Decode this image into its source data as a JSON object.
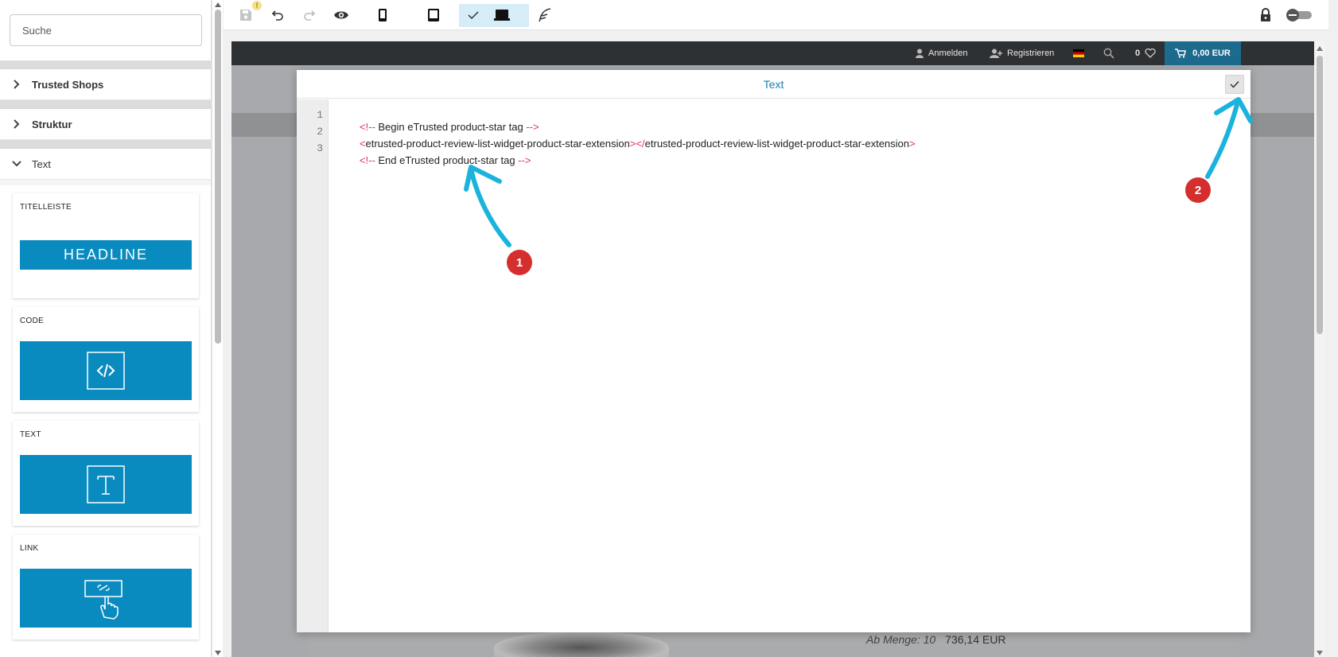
{
  "sidebar": {
    "search": {
      "placeholder": "Suche",
      "value": ""
    },
    "sections": [
      {
        "label": "Trusted Shops",
        "expanded": false
      },
      {
        "label": "Struktur",
        "expanded": false
      },
      {
        "label": "Text",
        "expanded": true
      }
    ],
    "widgets": [
      {
        "title": "TITELLEISTE",
        "preview": "HEADLINE",
        "icon": "headline-icon"
      },
      {
        "title": "CODE",
        "icon": "code-icon"
      },
      {
        "title": "TEXT",
        "icon": "text-icon"
      },
      {
        "title": "LINK",
        "icon": "link-click-icon"
      }
    ]
  },
  "toolbar": {
    "save_warning": "!",
    "icons": [
      "save-icon",
      "undo-icon",
      "redo-icon",
      "preview-eye-icon",
      "mobile-icon",
      "tablet-icon",
      "checkmark-icon",
      "desktop-icon",
      "feather-icon",
      "lock-icon",
      "toggle-switch"
    ]
  },
  "shop_header": {
    "login": "Anmelden",
    "register": "Registrieren",
    "wishlist_count": "0",
    "cart_total": "0,00 EUR"
  },
  "modal": {
    "title": "Text",
    "code_lines": [
      {
        "num": "1",
        "parts": [
          {
            "t": "<!-- ",
            "tag": true
          },
          {
            "t": "Begin eTrusted product-star tag",
            "tag": false
          },
          {
            "t": " -->",
            "tag": true
          }
        ]
      },
      {
        "num": "2",
        "parts": [
          {
            "t": "<",
            "tag": true
          },
          {
            "t": "etrusted-product-review-list-widget-product-star-extension",
            "tag": false
          },
          {
            "t": "></",
            "tag": true
          },
          {
            "t": "etrusted-product-review-list-widget-product-star-extension",
            "tag": false
          },
          {
            "t": ">",
            "tag": true
          }
        ]
      },
      {
        "num": "3",
        "parts": [
          {
            "t": "<!-- ",
            "tag": true
          },
          {
            "t": "End eTrusted product-star tag",
            "tag": false
          },
          {
            "t": " -->",
            "tag": true
          }
        ]
      }
    ]
  },
  "background_page": {
    "price_qty": "Ab Menge: 10",
    "price_value": "736,14 EUR"
  },
  "annotations": {
    "badge1": "1",
    "badge2": "2"
  },
  "colors": {
    "accent": "#0a8bc0",
    "title_blue": "#1a7fad",
    "annotation_arrow": "#1ab3dc",
    "annotation_badge": "#d42e2e",
    "code_tag": "#e0306a"
  }
}
